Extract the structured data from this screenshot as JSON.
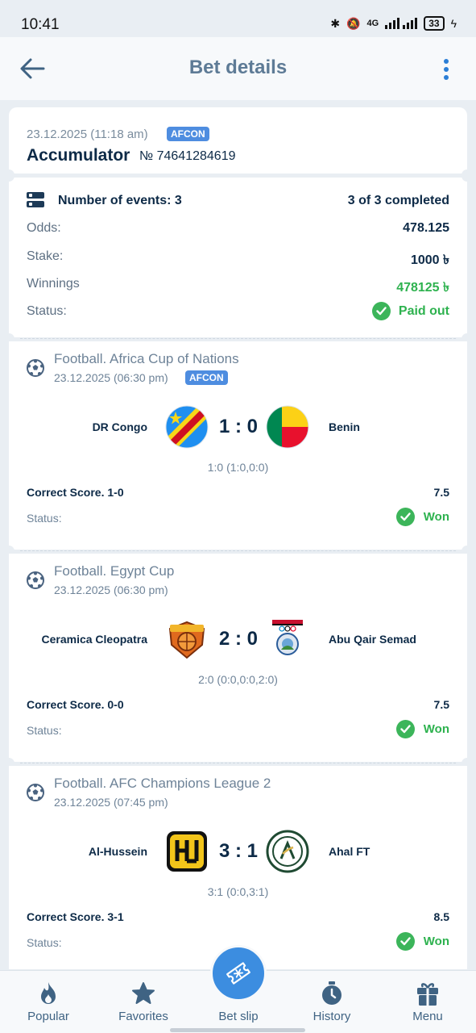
{
  "status_bar": {
    "time": "10:41",
    "network": "4G",
    "battery": "33"
  },
  "header": {
    "title": "Bet details",
    "back_icon": "arrow-left-icon",
    "more_icon": "more-vertical-icon"
  },
  "bet": {
    "datetime": "23.12.2025 (11:18 am)",
    "badge": "AFCON",
    "type": "Accumulator",
    "number": "№ 74641284619"
  },
  "summary": {
    "events_label": "Number of events: 3",
    "completed": "3 of 3 completed",
    "odds_label": "Odds:",
    "odds_value": "478.125",
    "stake_label": "Stake:",
    "stake_value": "1000 ৳",
    "winnings_label": "Winnings",
    "winnings_value": "478125 ৳",
    "status_label": "Status:",
    "status_value": "Paid out"
  },
  "events": [
    {
      "league": "Football. Africa Cup of Nations",
      "datetime": "23.12.2025 (06:30 pm)",
      "badge": "AFCON",
      "home": "DR Congo",
      "away": "Benin",
      "score": "1 : 0",
      "sub_score": "1:0 (1:0,0:0)",
      "market": "Correct Score. 1-0",
      "odds": "7.5",
      "status_label": "Status:",
      "result": "Won"
    },
    {
      "league": "Football. Egypt Cup",
      "datetime": "23.12.2025 (06:30 pm)",
      "home": "Ceramica Cleopatra",
      "away": "Abu Qair Semad",
      "score": "2 : 0",
      "sub_score": "2:0 (0:0,0:0,2:0)",
      "market": "Correct Score. 0-0",
      "odds": "7.5",
      "status_label": "Status:",
      "result": "Won"
    },
    {
      "league": "Football. AFC Champions League 2",
      "datetime": "23.12.2025 (07:45 pm)",
      "home": "Al-Hussein",
      "away": "Ahal FT",
      "score": "3 : 1",
      "sub_score": "3:1 (0:0,3:1)",
      "market": "Correct Score. 3-1",
      "odds": "8.5",
      "status_label": "Status:",
      "result": "Won"
    }
  ],
  "nav": {
    "items": [
      {
        "label": "Popular",
        "icon": "fire-icon"
      },
      {
        "label": "Favorites",
        "icon": "star-icon"
      },
      {
        "label": "Bet slip",
        "icon": "ticket-icon"
      },
      {
        "label": "History",
        "icon": "stopwatch-icon"
      },
      {
        "label": "Menu",
        "icon": "gift-icon"
      }
    ]
  },
  "colors": {
    "accent": "#3c8de0",
    "success": "#2eb24f",
    "title": "#5e7b96",
    "text": "#0d2a47"
  }
}
